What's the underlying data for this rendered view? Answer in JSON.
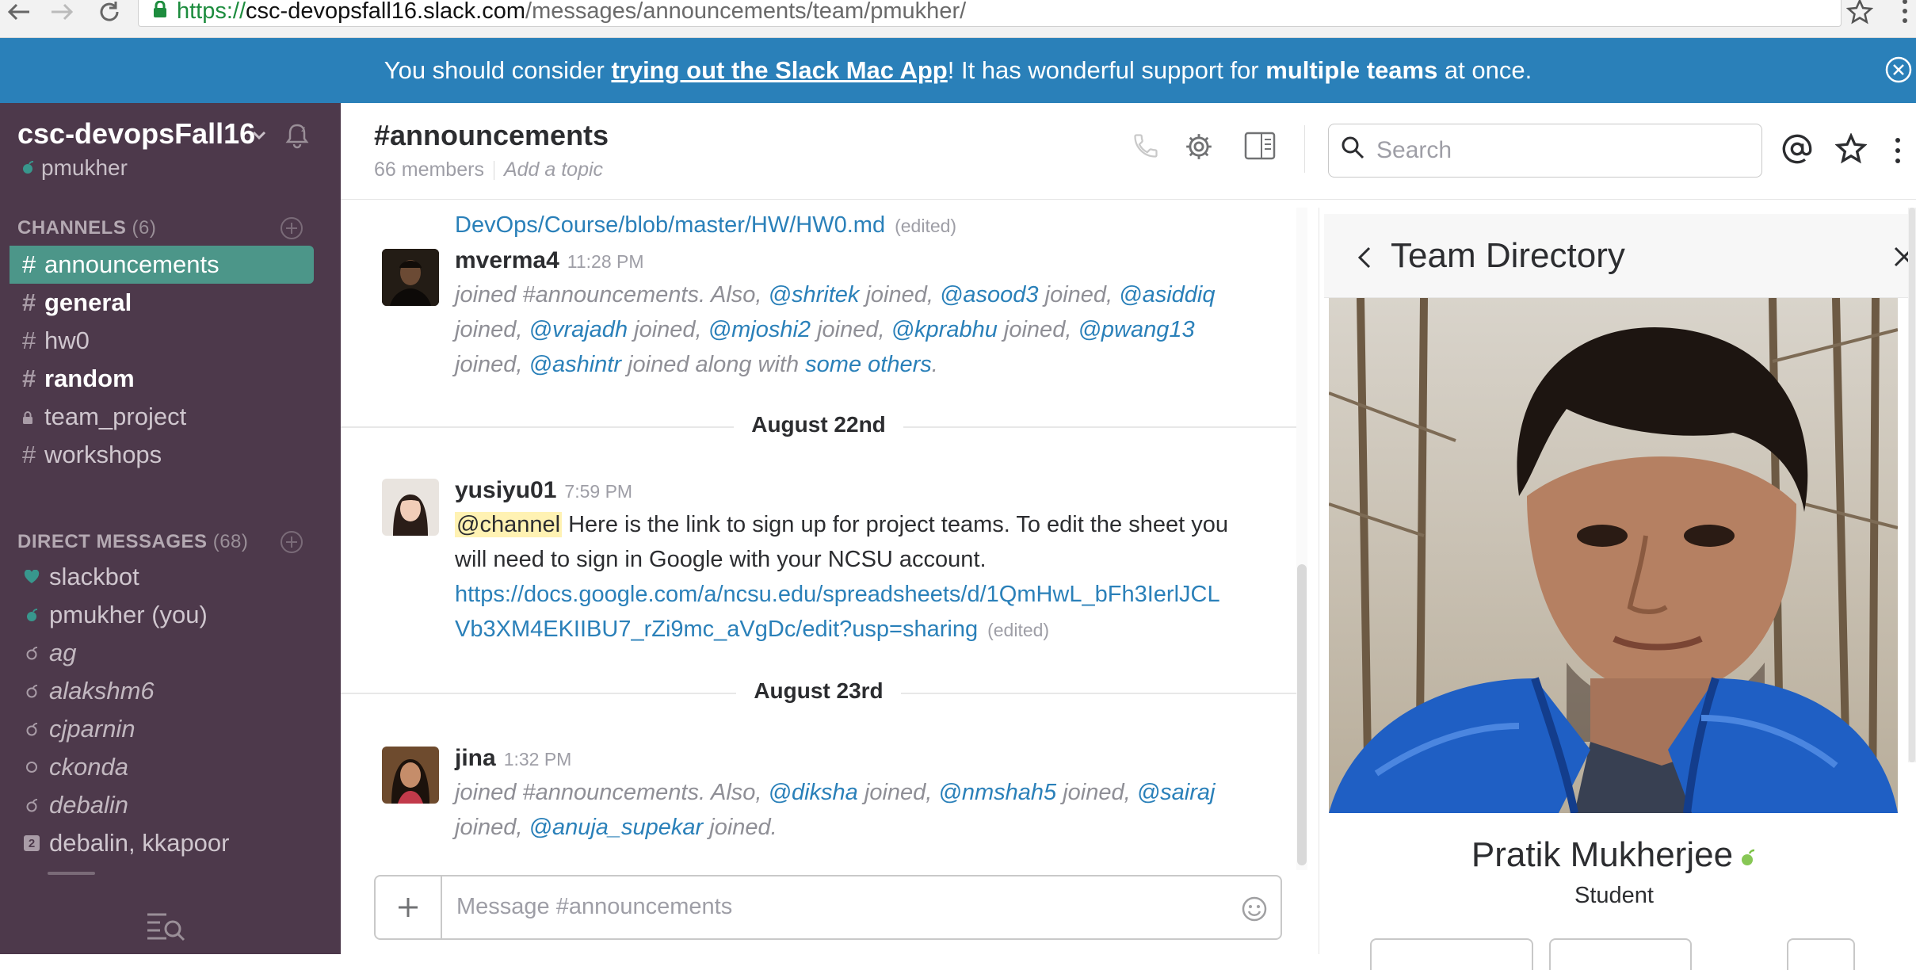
{
  "browser": {
    "url_protocol": "https://",
    "url_host": "csc-devopsfall16.slack.com",
    "url_path": "/messages/announcements/team/pmukher/"
  },
  "banner": {
    "text_before": "You should consider ",
    "link_text": "trying out the Slack Mac App",
    "text_middle": "! It has wonderful support for ",
    "bold_text": "multiple teams",
    "text_after": " at once."
  },
  "sidebar": {
    "team_name": "csc-devopsFall16",
    "user_name": "pmukher",
    "channels_header": "CHANNELS",
    "channels_count": "(6)",
    "channels": [
      {
        "prefix": "#",
        "name": "announcements"
      },
      {
        "prefix": "#",
        "name": "general"
      },
      {
        "prefix": "#",
        "name": "hw0"
      },
      {
        "prefix": "#",
        "name": "random"
      },
      {
        "prefix": "lock",
        "name": "team_project"
      },
      {
        "prefix": "#",
        "name": "workshops"
      }
    ],
    "dm_header": "DIRECT MESSAGES",
    "dm_count": "(68)",
    "dms": [
      {
        "status": "heart",
        "name": "slackbot"
      },
      {
        "status": "active",
        "name": "pmukher (you)"
      },
      {
        "status": "away",
        "name": "ag"
      },
      {
        "status": "away",
        "name": "alakshm6"
      },
      {
        "status": "away",
        "name": "cjparnin"
      },
      {
        "status": "offline",
        "name": "ckonda"
      },
      {
        "status": "away",
        "name": "debalin"
      },
      {
        "status": "group",
        "name": "debalin, kkapoor",
        "group_count": "2"
      }
    ]
  },
  "channel": {
    "title": "#announcements",
    "members": "66 members",
    "topic_placeholder": "Add a topic",
    "search_placeholder": "Search"
  },
  "messages": {
    "top_fragment": {
      "link": "DevOps/Course/blob/master/HW/HW0.md",
      "edited": "(edited)"
    },
    "m1": {
      "author": "mverma4",
      "time": "11:28 PM",
      "p1": "joined #announcements. Also, ",
      "mentions": [
        "@shritek",
        "@asood3",
        "@asiddiq",
        "@vrajadh",
        "@mjoshi2",
        "@kprabhu",
        "@pwang13",
        "@ashintr"
      ],
      "joined": " joined, ",
      "joined_along": " joined along with ",
      "others": "some others",
      "period": "."
    },
    "day1": "August 22nd",
    "m2": {
      "author": "yusiyu01",
      "time": "7:59 PM",
      "channel_mention": "@channel",
      "text": " Here is the link to sign up for project teams. To edit the sheet you will need to sign in Google with your NCSU account.",
      "link_line1": "https://docs.google.com/a/ncsu.edu/spreadsheets/d/1QmHwL_bFh3IerlJCL",
      "link_line2": "Vb3XM4EKIIBU7_rZi9mc_aVgDc/edit?usp=sharing",
      "edited": "(edited)"
    },
    "day2": "August 23rd",
    "m3": {
      "author": "jina",
      "time": "1:32 PM",
      "p1": "joined #announcements. Also, ",
      "mentions": [
        "@diksha",
        "@nmshah5",
        "@sairaj",
        "@anuja_supekar"
      ],
      "joined": " joined, ",
      "joined_end": " joined."
    }
  },
  "composer": {
    "placeholder": "Message #announcements"
  },
  "team_directory": {
    "title": "Team Directory",
    "profile_name": "Pratik Mukherjee",
    "profile_role": "Student"
  },
  "colors": {
    "sidebar_bg": "#4d394b",
    "active_channel": "#4c9689",
    "banner_bg": "#2a80b9",
    "link": "#2a80b9",
    "presence_active": "#38978d"
  },
  "icons": {
    "back": "back-arrow-icon",
    "forward": "forward-arrow-icon",
    "reload": "reload-icon",
    "lock": "lock-icon",
    "star": "star-icon",
    "menu": "vertical-dots-icon",
    "bell": "bell-snooze-icon",
    "phone": "phone-icon",
    "gear": "gear-icon",
    "sidebar_toggle": "sidebar-toggle-icon",
    "search": "search-icon",
    "mentions": "at-sign-icon",
    "emoji": "emoji-icon",
    "quick_switcher": "quick-switcher-icon"
  }
}
